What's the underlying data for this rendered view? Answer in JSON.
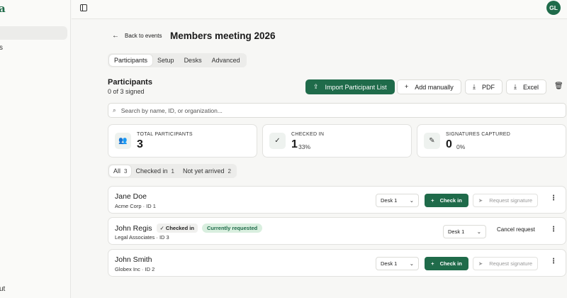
{
  "sidebar": {
    "brand": "a",
    "partial_item": "s",
    "footer_partial": "ut"
  },
  "user": {
    "initials": "GL"
  },
  "header": {
    "back_label": "Back to events",
    "back_icon": "arrow-left-icon",
    "title": "Members meeting 2026"
  },
  "tabs": [
    {
      "label": "Participants",
      "active": true
    },
    {
      "label": "Setup"
    },
    {
      "label": "Desks"
    },
    {
      "label": "Advanced"
    }
  ],
  "section": {
    "title": "Participants",
    "subtitle": "0 of 3 signed"
  },
  "actions": {
    "import_label": "Import Participant List",
    "add_label": "Add manually",
    "pdf_label": "PDF",
    "excel_label": "Excel"
  },
  "search": {
    "placeholder": "Search by name, ID, or organization..."
  },
  "stats": [
    {
      "label": "TOTAL PARTICIPANTS",
      "value": "3",
      "percent": "",
      "icon": "users-icon"
    },
    {
      "label": "CHECKED IN",
      "value": "1",
      "percent": "33%",
      "icon": "user-check-icon"
    },
    {
      "label": "SIGNATURES CAPTURED",
      "value": "0",
      "percent": "0%",
      "icon": "pen-icon"
    }
  ],
  "filters": [
    {
      "label": "All",
      "count": "3",
      "active": true
    },
    {
      "label": "Checked in",
      "count": "1"
    },
    {
      "label": "Not yet arrived",
      "count": "2"
    }
  ],
  "participants": [
    {
      "name": "Jane Doe",
      "meta": "Acme Corp · ID 1",
      "desk": "Desk 1",
      "action": "Check in",
      "secondary": "Request signature"
    },
    {
      "name": "John Regis",
      "meta": "Legal Associates · ID 3",
      "status_badge": "Checked in",
      "request_badge": "Currently requested",
      "desk": "Desk 1",
      "secondary": "Cancel request"
    },
    {
      "name": "John Smith",
      "meta": "Globex Inc · ID 2",
      "desk": "Desk 1",
      "action": "Check in",
      "secondary": "Request signature"
    }
  ],
  "colors": {
    "accent": "#1f6b4a",
    "accent_soft": "#d9efdf",
    "background": "#f7f7f5"
  }
}
